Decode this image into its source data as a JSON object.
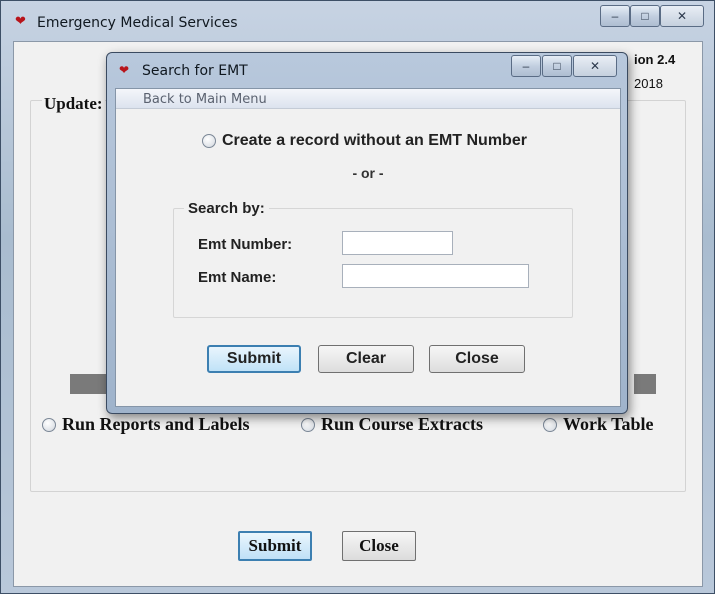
{
  "main_window": {
    "title": "Emergency Medical Services",
    "version_label": "ion 2.4",
    "version_date": "2018",
    "update_label": "Update:",
    "controls": {
      "minimize": "–",
      "restore": "□",
      "close": "✕"
    },
    "radio_options": [
      {
        "label": "Run Reports and Labels"
      },
      {
        "label": "Run Course Extracts"
      },
      {
        "label": "Work Table"
      }
    ],
    "submit_label": "Submit",
    "close_label": "Close"
  },
  "dialog": {
    "title": "Search for EMT",
    "menu": {
      "back_label": "Back to Main Menu"
    },
    "controls": {
      "minimize": "–",
      "restore": "□",
      "close": "✕"
    },
    "create_option_label": "Create a record without an EMT Number",
    "or_text": "- or -",
    "search_by_label": "Search by:",
    "fields": {
      "emt_number_label": "Emt Number:",
      "emt_number_value": "",
      "emt_name_label": "Emt Name:",
      "emt_name_value": ""
    },
    "buttons": {
      "submit": "Submit",
      "clear": "Clear",
      "close": "Close"
    }
  },
  "icons": {
    "app_icon": "heart-icon"
  },
  "colors": {
    "heart": "#b8141b",
    "default_button_border": "#3c7fb1",
    "title_bar": "#b8c8dc"
  }
}
